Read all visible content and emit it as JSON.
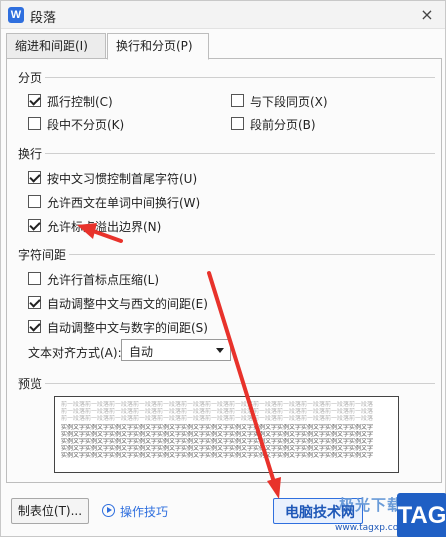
{
  "window": {
    "app_icon_letter": "W",
    "title": "段落",
    "close_label": "×"
  },
  "tabs": [
    {
      "label": "缩进和间距(I)",
      "active": false
    },
    {
      "label": "换行和分页(P)",
      "active": true
    }
  ],
  "sections": {
    "pagination": {
      "label": "分页",
      "options": [
        {
          "label": "孤行控制(C)",
          "checked": true
        },
        {
          "label": "与下段同页(X)",
          "checked": false
        },
        {
          "label": "段中不分页(K)",
          "checked": false
        },
        {
          "label": "段前分页(B)",
          "checked": false
        }
      ]
    },
    "linebreak": {
      "label": "换行",
      "options": [
        {
          "label": "按中文习惯控制首尾字符(U)",
          "checked": true
        },
        {
          "label": "允许西文在单词中间换行(W)",
          "checked": false
        },
        {
          "label": "允许标点溢出边界(N)",
          "checked": true
        }
      ]
    },
    "spacing": {
      "label": "字符间距",
      "options": [
        {
          "label": "允许行首标点压缩(L)",
          "checked": false
        },
        {
          "label": "自动调整中文与西文的间距(E)",
          "checked": true
        },
        {
          "label": "自动调整中文与数字的间距(S)",
          "checked": true
        }
      ],
      "align_label": "文本对齐方式(A):",
      "align_value": "自动"
    },
    "preview": {
      "label": "预览",
      "prev_line": "前一段落前一段落前一段落前一段落前一段落前一段落前一段落前一段落前一段落前一段落前一段落前一段落前一段落",
      "sample_line": "实例文字实例文字实例文字实例文字实例文字实例文字实例文字实例文字实例文字实例文字实例文字实例文字实例文字"
    }
  },
  "footer": {
    "tab_button": "制表位(T)...",
    "tips_label": "操作技巧"
  },
  "watermark": {
    "top_text": "极光下载站",
    "main_text": "电脑技术网",
    "url": "www.tagxp.com",
    "badge": "TAG"
  },
  "colors": {
    "accent": "#2f6fde",
    "annotation_arrow": "#e8322b"
  }
}
